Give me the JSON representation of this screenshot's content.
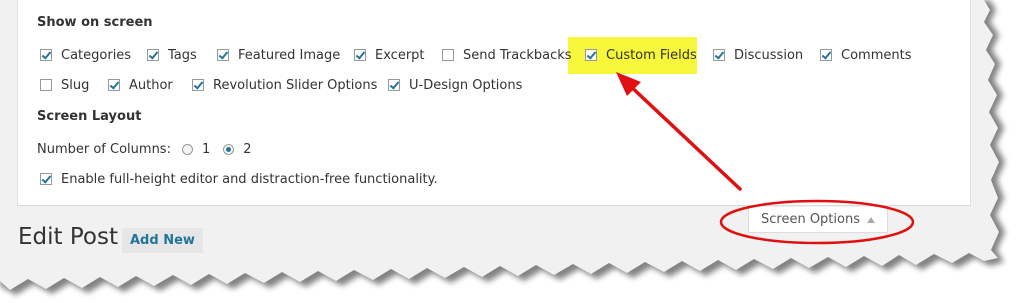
{
  "screen_options": {
    "show_on_screen_title": "Show on screen",
    "items": [
      {
        "label": "Categories",
        "checked": true
      },
      {
        "label": "Tags",
        "checked": true
      },
      {
        "label": "Featured Image",
        "checked": true
      },
      {
        "label": "Excerpt",
        "checked": true
      },
      {
        "label": "Send Trackbacks",
        "checked": false
      },
      {
        "label": "Custom Fields",
        "checked": true
      },
      {
        "label": "Discussion",
        "checked": true
      },
      {
        "label": "Comments",
        "checked": true
      },
      {
        "label": "Slug",
        "checked": false
      },
      {
        "label": "Author",
        "checked": true
      },
      {
        "label": "Revolution Slider Options",
        "checked": true
      },
      {
        "label": "U-Design Options",
        "checked": true
      }
    ],
    "layout_title": "Screen Layout",
    "columns_label": "Number of Columns:",
    "column_options": [
      "1",
      "2"
    ],
    "selected_columns": "2",
    "distraction_free_label": "Enable full-height editor and distraction-free functionality.",
    "distraction_free_checked": true,
    "tab_label": "Screen Options"
  },
  "page": {
    "title": "Edit Post",
    "add_new_label": "Add New"
  },
  "annotations": {
    "highlight_color": "#f6f63a",
    "arrow_color": "#e01010",
    "ellipse_color": "#e01010"
  }
}
